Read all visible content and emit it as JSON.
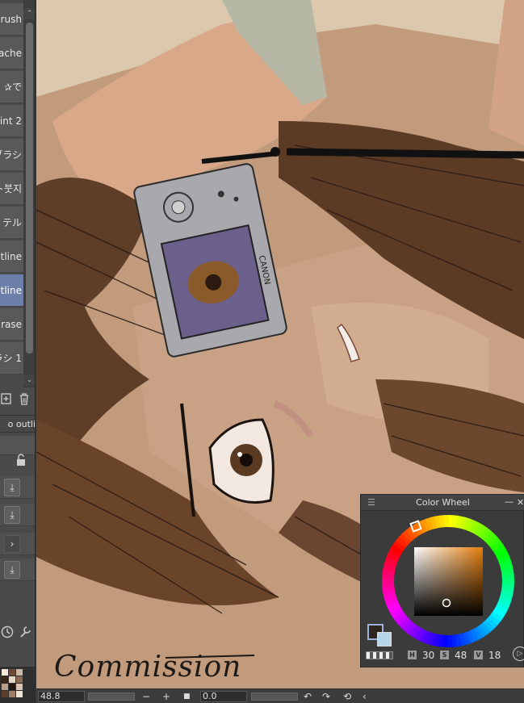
{
  "brush_panel": {
    "items": [
      {
        "label": "rush"
      },
      {
        "label": "ache"
      },
      {
        "label": "で✰"
      },
      {
        "label": "int 2"
      },
      {
        "label": "ブラシ"
      },
      {
        "label": "ト붓지"
      },
      {
        "label": "テル"
      },
      {
        "label": "utline"
      },
      {
        "label": "utline"
      },
      {
        "label": "rase"
      },
      {
        "label": "ラシ 1"
      }
    ],
    "selected_index": 8,
    "sub_tool_label": "o outli",
    "scroll_up_glyph": "⌃",
    "scroll_down_glyph": "⌄",
    "lock_glyph": "🔓",
    "download_glyph": "⤓",
    "chevron_glyph": "›"
  },
  "canvas": {
    "watermark": "Commission",
    "camera_brand": "CANON"
  },
  "color_wheel": {
    "title": "Color Wheel",
    "menu_glyph": "☰",
    "minimize_glyph": "—",
    "close_glyph": "✕",
    "h_label": "H",
    "h_value": "30",
    "s_label": "S",
    "s_value": "48",
    "v_label": "V",
    "v_value": "18",
    "hue_color": "#e47d0c",
    "main_color": "#2e2420",
    "sub_color": "#b8d6ea",
    "play_glyph": "▷"
  },
  "status_bar": {
    "zoom_value": "48.8",
    "zoom_out_glyph": "−",
    "zoom_in_glyph": "+",
    "stop_glyph": "■",
    "angle_value": "0.0",
    "rotate_left_glyph": "↶",
    "rotate_right_glyph": "↷",
    "reset_glyph": "⟲",
    "collapse_glyph": "‹"
  }
}
